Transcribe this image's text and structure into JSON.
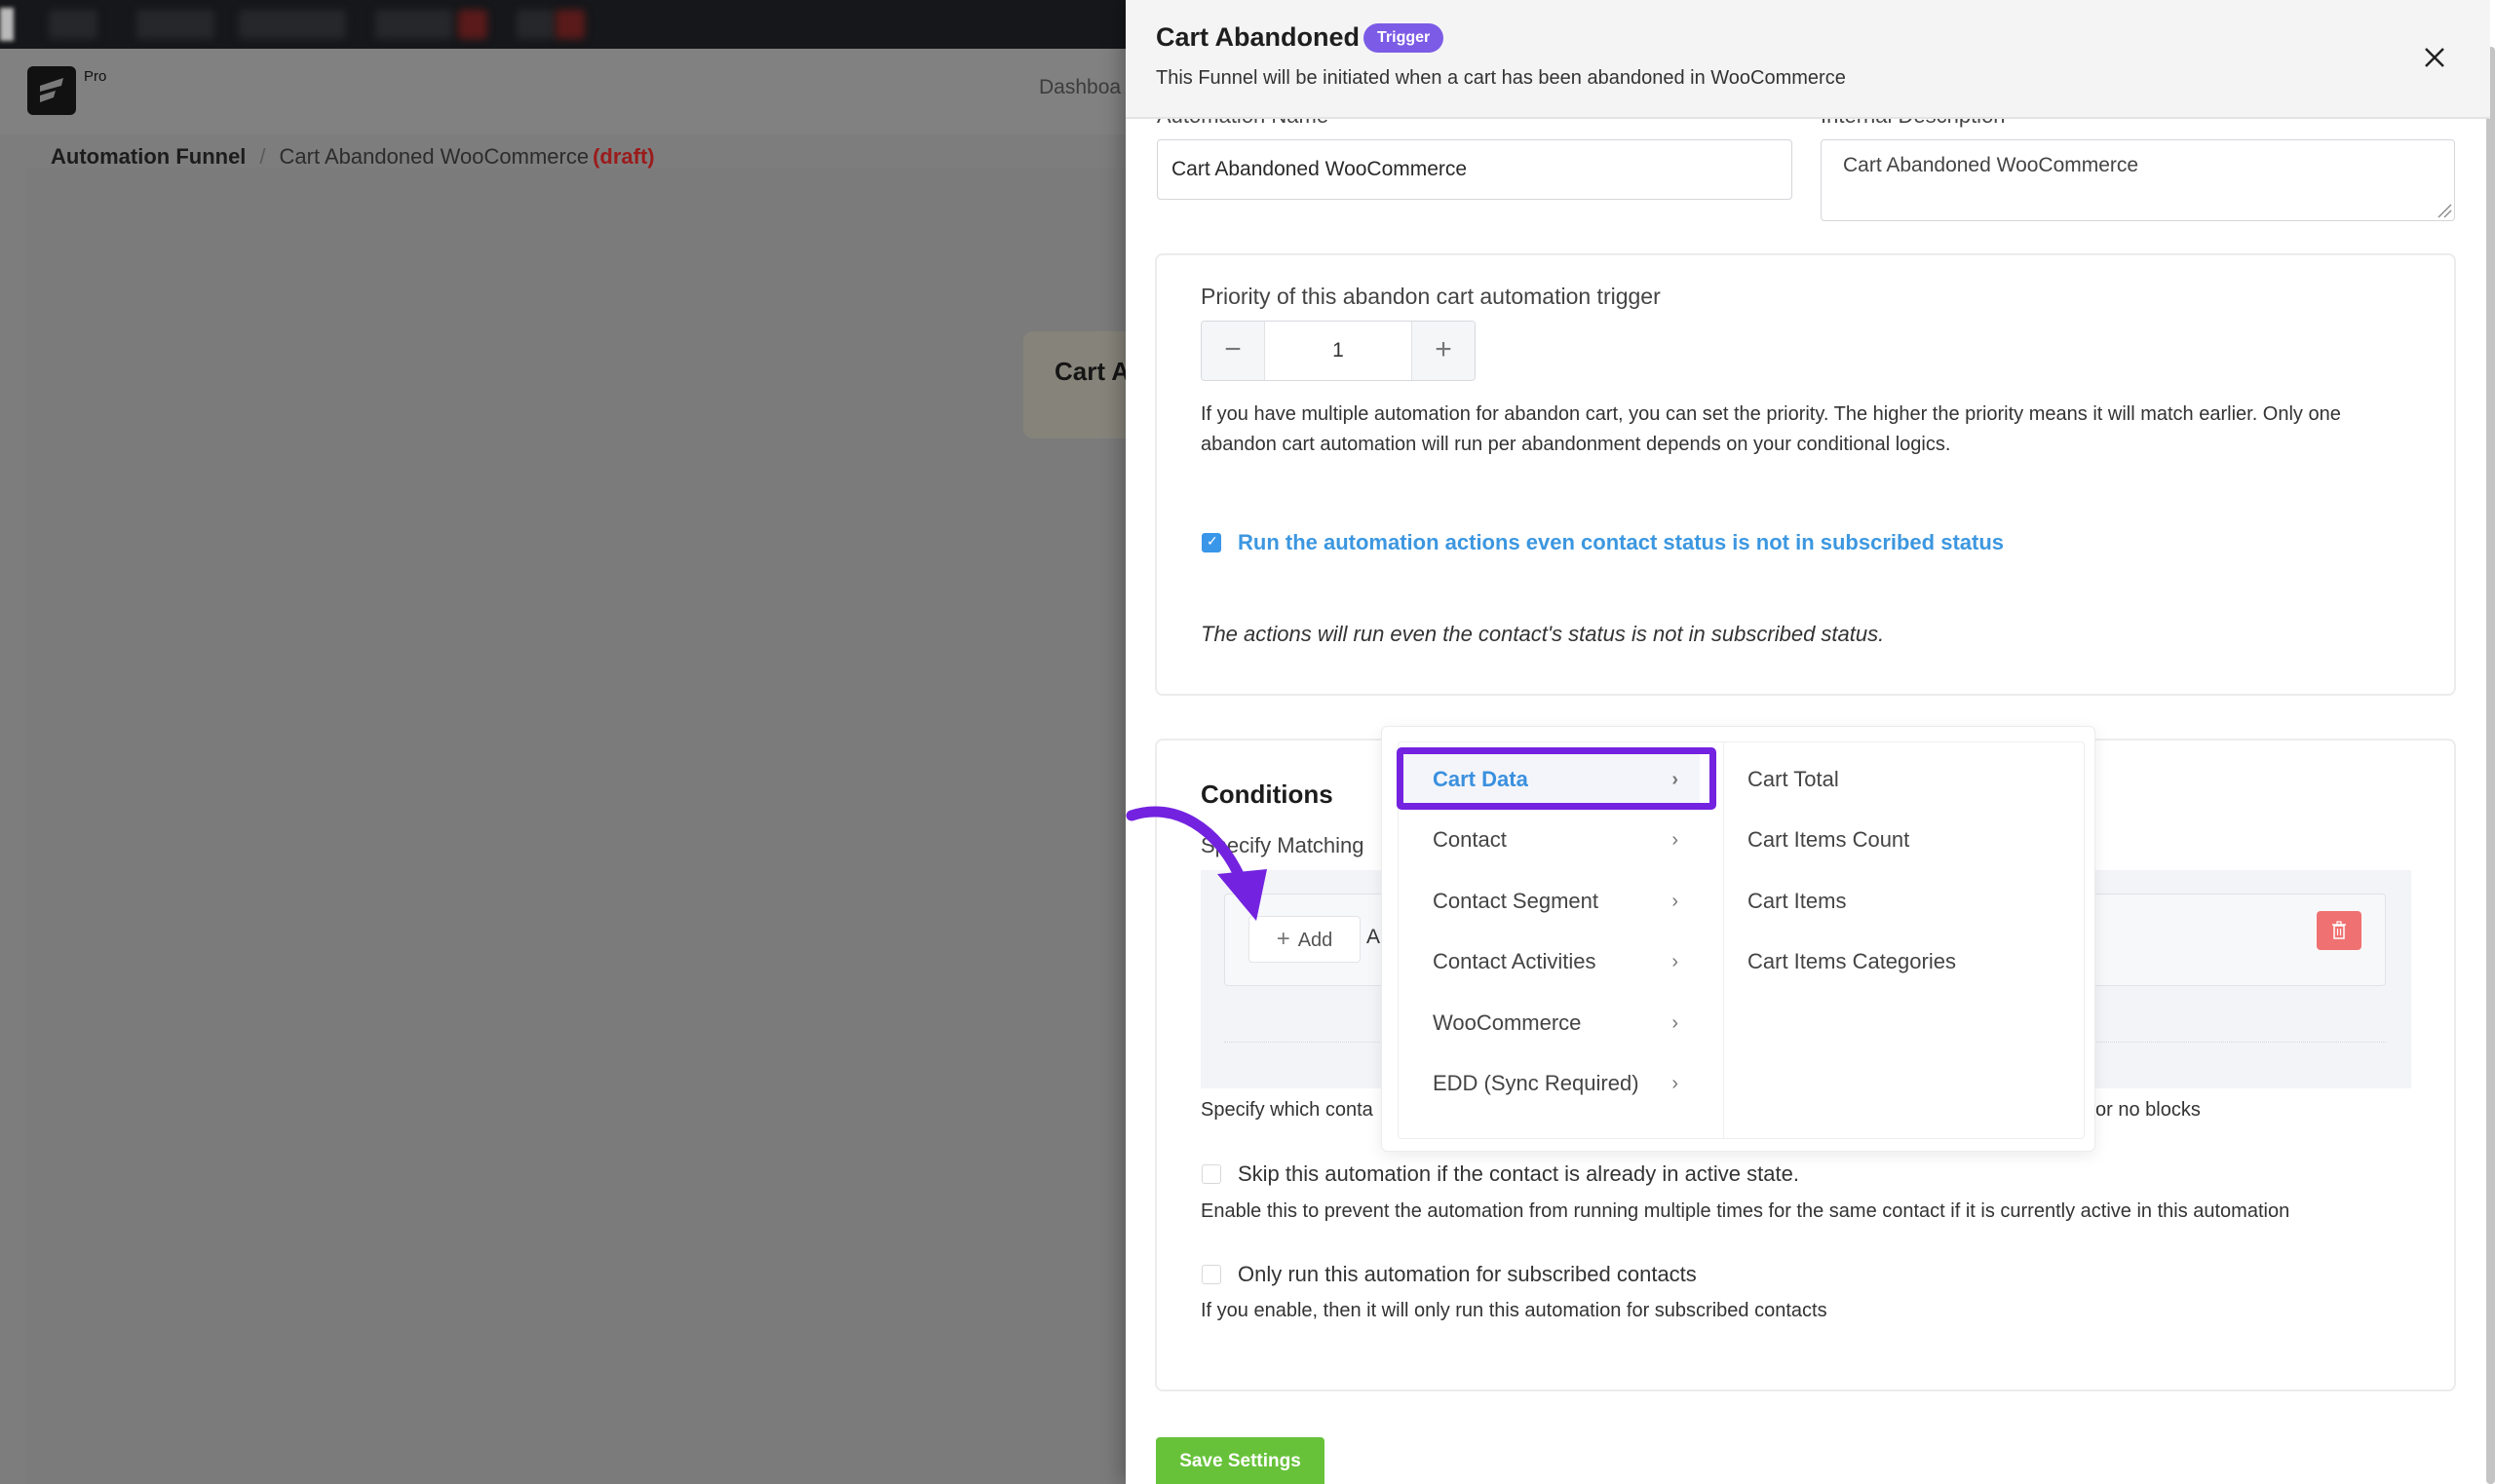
{
  "background": {
    "logo_badge": "Pro",
    "nav_item": "Dashboa",
    "breadcrumb": {
      "root": "Automation Funnel",
      "separator": "/",
      "current": "Cart Abandoned WooCommerce",
      "status": "(draft)"
    },
    "funnel_node_label": "Cart A"
  },
  "drawer": {
    "title": "Cart Abandoned",
    "badge": "Trigger",
    "subtitle": "This Funnel will be initiated when a cart has been abandoned in WooCommerce",
    "fields": {
      "name_label": "Automation Name",
      "name_value": "Cart Abandoned WooCommerce",
      "description_label": "Internal Description",
      "description_value": "Cart Abandoned WooCommerce"
    },
    "priority": {
      "label": "Priority of this abandon cart automation trigger",
      "value": "1",
      "minus": "−",
      "plus": "+",
      "help": "If you have multiple automation for abandon cart, you can set the priority. The higher the priority means it will match earlier. Only one abandon cart automation will run per abandonment depends on your conditional logics."
    },
    "run_non_subscribed": {
      "checked": true,
      "label": "Run the automation actions even contact status is not in subscribed status",
      "help": "The actions will run even the contact's status is not in subscribed status."
    },
    "conditions": {
      "title": "Conditions",
      "subtitle_visible": "Specify Matching",
      "add_label": "Add",
      "add_next_fragment": "A",
      "footer_left_visible": "Specify which conta",
      "footer_right_visible": "or no blocks"
    },
    "skip_active": {
      "checked": false,
      "label": "Skip this automation if the contact is already in active state.",
      "help": "Enable this to prevent the automation from running multiple times for the same contact if it is currently active in this automation"
    },
    "only_subscribed": {
      "checked": false,
      "label": "Only run this automation for subscribed contacts",
      "help": "If you enable, then it will only run this automation for subscribed contacts"
    },
    "save_label": "Save Settings"
  },
  "dropdown": {
    "categories": [
      {
        "label": "Cart Data",
        "active": true
      },
      {
        "label": "Contact",
        "active": false
      },
      {
        "label": "Contact Segment",
        "active": false
      },
      {
        "label": "Contact Activities",
        "active": false
      },
      {
        "label": "WooCommerce",
        "active": false
      },
      {
        "label": "EDD (Sync Required)",
        "active": false
      }
    ],
    "chevron": "›",
    "sub_items": [
      "Cart Total",
      "Cart Items Count",
      "Cart Items",
      "Cart Items Categories"
    ]
  },
  "colors": {
    "accent_purple": "#7322e0",
    "badge_purple": "#7c5ce6",
    "link_blue": "#3a90de",
    "save_green": "#67c23a",
    "delete_red": "#f07171",
    "draft_red": "#9b1b1b"
  }
}
